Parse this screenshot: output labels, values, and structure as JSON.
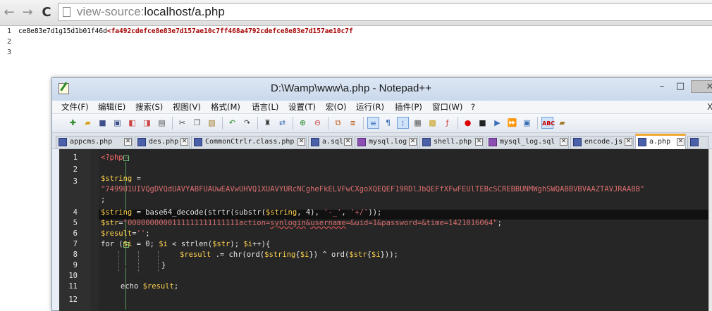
{
  "browser": {
    "url_prefix": "view-source:",
    "url_host": "localhost/a.php",
    "back_glyph": "←",
    "forward_glyph": "→",
    "reload_glyph": "C",
    "source_line_numbers": [
      "1",
      "2",
      "3"
    ],
    "source_text_plain": "ce8e83e7d1g15d1b01f46d",
    "source_text_tag": "<fa492cdefce8e83e7d157ae10c7ff468a4792cdefce8e83e7d157ae10c7f"
  },
  "notepad": {
    "title": "D:\\Wamp\\www\\a.php - Notepad++",
    "minimize_glyph": "–",
    "maximize_glyph": "□",
    "close_glyph": "✕",
    "menu_close_glyph": "X",
    "menu": [
      "文件(F)",
      "编辑(E)",
      "搜索(S)",
      "视图(V)",
      "格式(M)",
      "语言(L)",
      "设置(T)",
      "宏(O)",
      "运行(R)",
      "插件(P)",
      "窗口(W)",
      "?"
    ],
    "tabs": [
      {
        "label": "appcms.php"
      },
      {
        "label": "des.php"
      },
      {
        "label": "CommonCtrlr.class.php"
      },
      {
        "label": "a.sql"
      },
      {
        "label": "mysql.log"
      },
      {
        "label": "shell.php"
      },
      {
        "label": "mysql_log.sql"
      },
      {
        "label": "encode.js"
      },
      {
        "label": "a.php"
      }
    ],
    "line_numbers": [
      "1",
      "2",
      "3",
      "4",
      "5",
      "6",
      "7",
      "8",
      "9",
      "10",
      "11",
      "12"
    ],
    "code": {
      "l1_open": "<?php",
      "l3_var": "$string",
      "l3_op": " =",
      "l3_str": "\"7499U1UIVQgDVQdUAVYABFUAUwEAVwUHVQ1XUAVYURcNCgheFkELVFwCXgoXQEQEF19RDlJbQEFfXFwFEUlTEBcSCREBBUNMWghSWQABBVBVAAZTAVJRAA8B\"",
      "l3_end": ";",
      "l4_var": "$string",
      "l4_mid": " = base64_decode(strtr(substr(",
      "l4_var2": "$string",
      "l4_mid2": ", 4), ",
      "l4_str1": "'-_'",
      "l4_comma": ", ",
      "l4_str2": "'+/'",
      "l4_end": "));",
      "l5_var": "$str",
      "l5_eq": "=",
      "l5_str_a": "\"0000000000111111111111111action=",
      "l5_str_b": "synlogin",
      "l5_str_c": "&",
      "l5_str_d": "username",
      "l5_str_e": "=&uid=1&password=&time=1421016064\"",
      "l5_end": ";",
      "l6_var": "$result",
      "l6_eq": "=",
      "l6_str": "''",
      "l6_end": ";",
      "l7_kw": "for (",
      "l7_v1": "$i",
      "l7_a": " = 0; ",
      "l7_v2": "$i",
      "l7_b": " < strlen(",
      "l7_v3": "$str",
      "l7_c": "); ",
      "l7_v4": "$i",
      "l7_d": "++){",
      "l8_v1": "$result",
      "l8_a": " .= chr(ord(",
      "l8_v2": "$string",
      "l8_b": "{",
      "l8_v3": "$i",
      "l8_c": "}) ^ ord(",
      "l8_v4": "$str",
      "l8_d": "{",
      "l8_v5": "$i",
      "l8_e": "}));",
      "l9": "}",
      "l11_kw": "echo ",
      "l11_var": "$result",
      "l11_end": ";"
    }
  }
}
